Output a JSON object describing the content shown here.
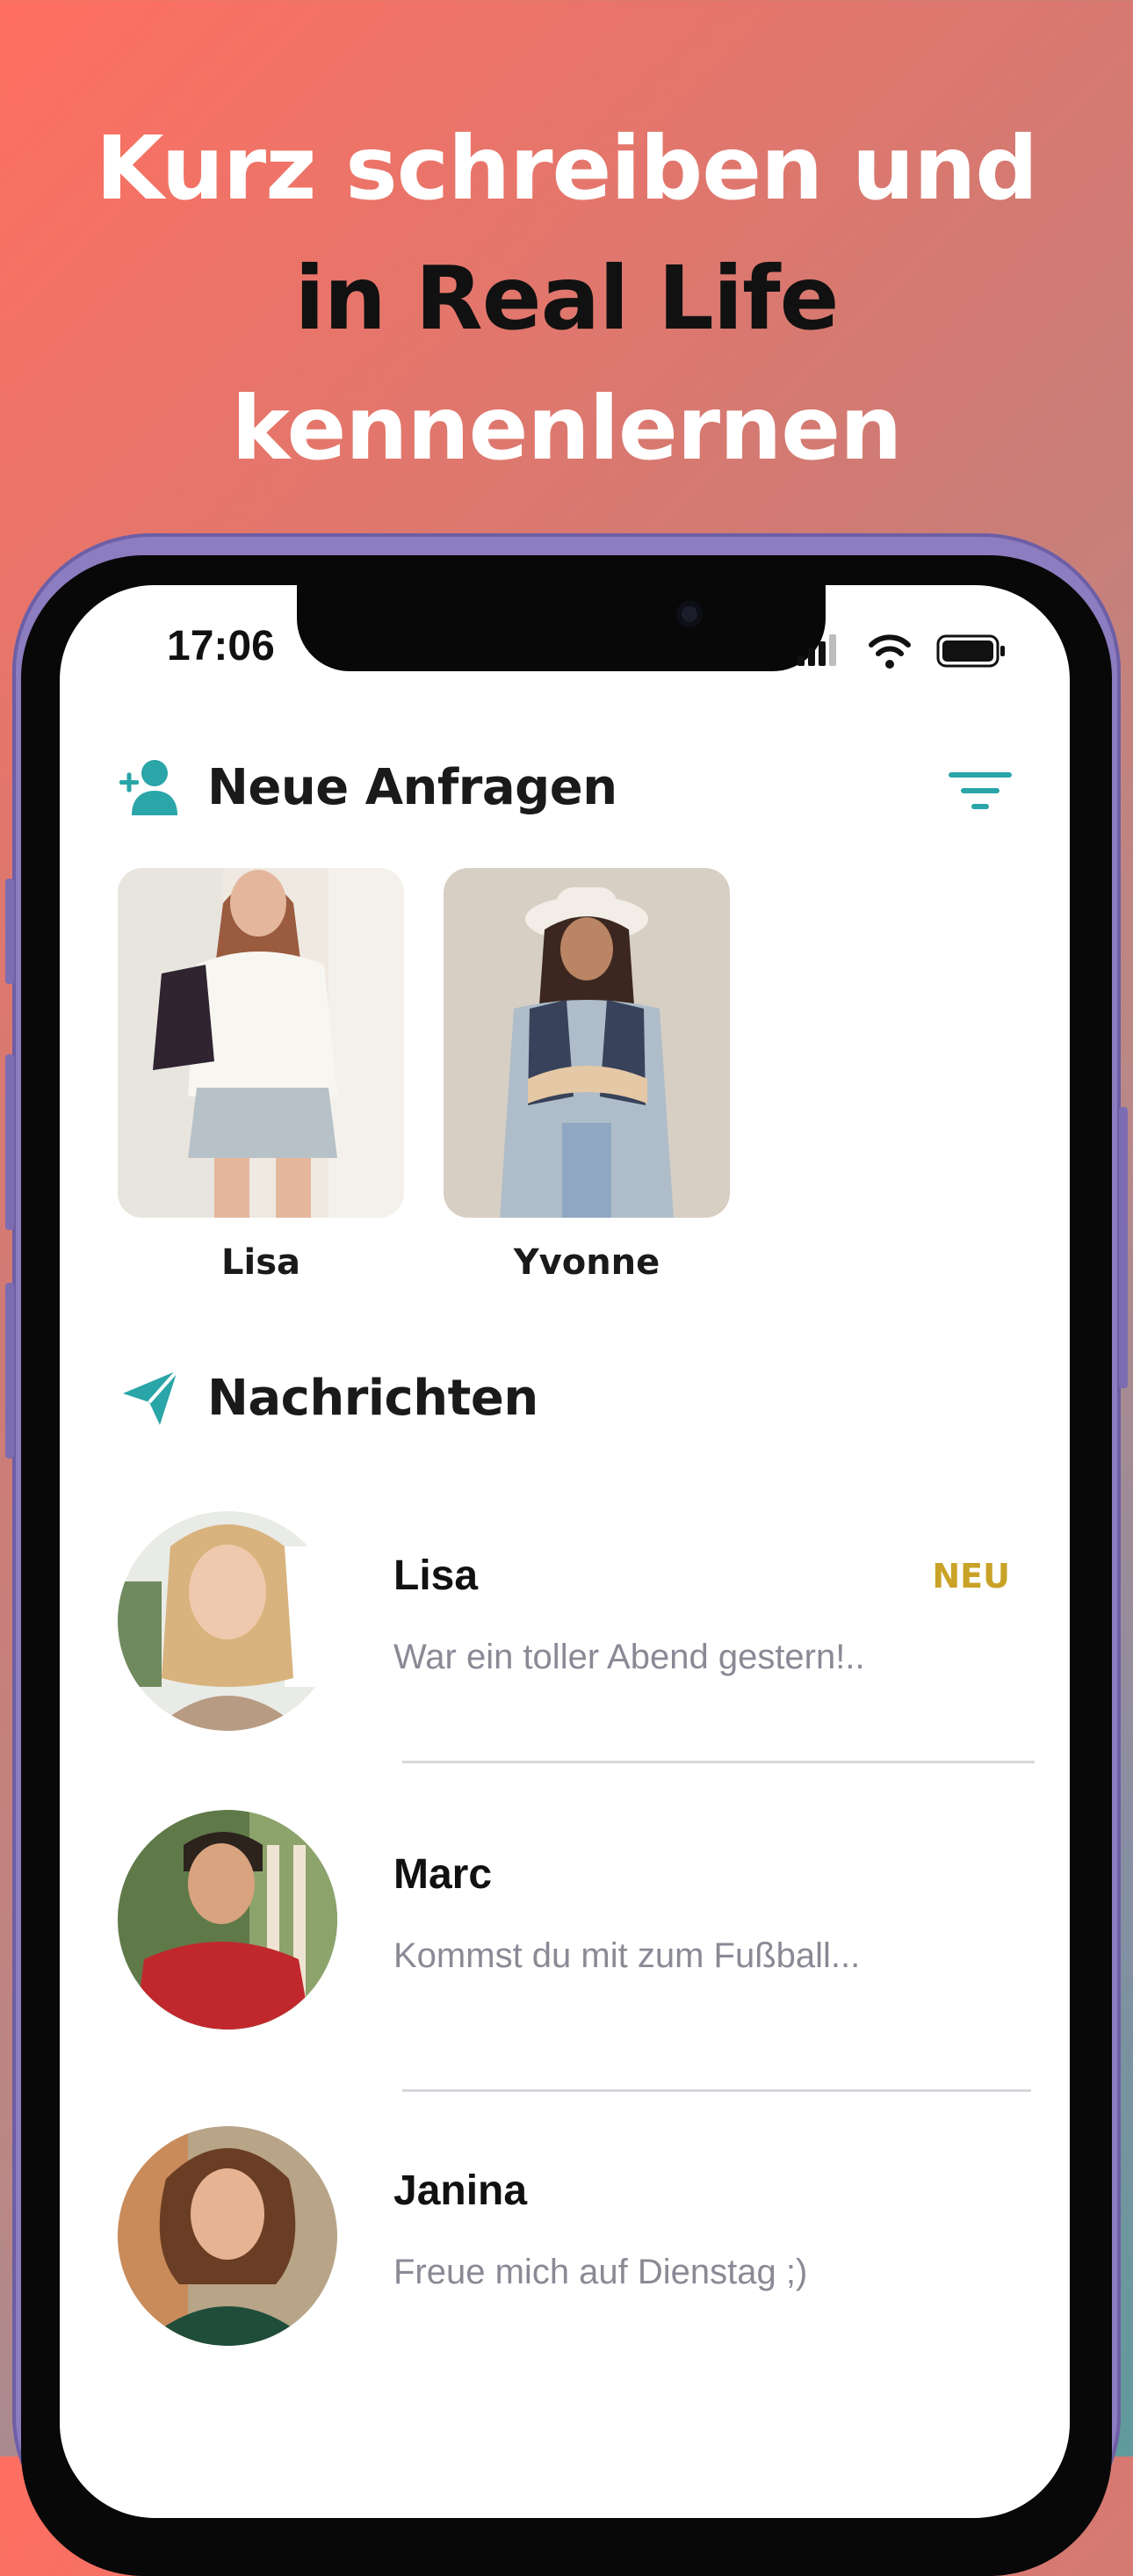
{
  "headline": {
    "line1": "Kurz schreiben und",
    "line2": "in Real Life",
    "line3": "kennenlernen"
  },
  "status_bar": {
    "time": "17:06",
    "icons": [
      "signal-icon",
      "wifi-icon",
      "battery-icon"
    ]
  },
  "requests": {
    "title": "Neue Anfragen",
    "icon": "add-user-icon",
    "filter_icon": "filter-icon",
    "items": [
      {
        "name": "Lisa"
      },
      {
        "name": "Yvonne"
      }
    ]
  },
  "messages": {
    "title": "Nachrichten",
    "icon": "send-icon",
    "items": [
      {
        "name": "Lisa",
        "preview": "War ein toller Abend gestern!..",
        "badge": "NEU"
      },
      {
        "name": "Marc",
        "preview": "Kommst du mit zum Fußball..."
      },
      {
        "name": "Janina",
        "preview": "Freue mich auf Dienstag ;)"
      }
    ]
  },
  "colors": {
    "accent": "#2aa5a8",
    "badge": "#c9a227",
    "phone_frame": "#8c7cc0"
  }
}
